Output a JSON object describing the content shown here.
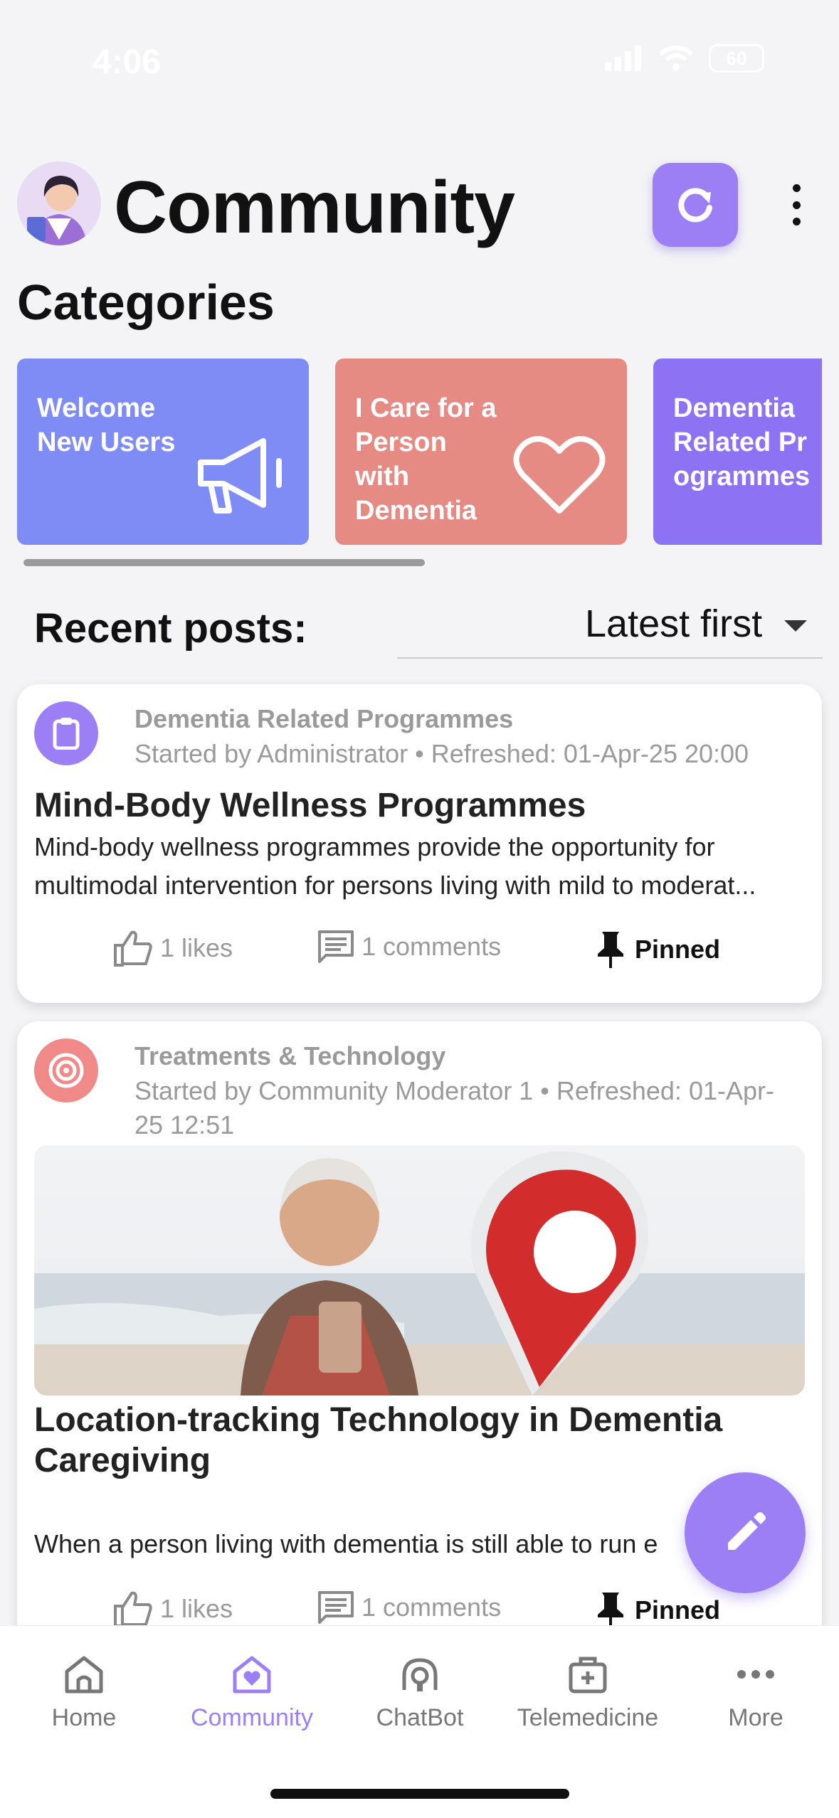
{
  "status_bar": {
    "time": "4:06",
    "battery": "60"
  },
  "header": {
    "title": "Community"
  },
  "categories_title": "Categories",
  "categories": [
    {
      "label": "Welcome\nNew Users",
      "color": "#7f8cf5",
      "icon": "megaphone-icon"
    },
    {
      "label": "I Care for a\nPerson\nwith\nDementia",
      "color": "#e58b84",
      "icon": "heart-icon"
    },
    {
      "label": "Dementia\nRelated Pr\nogrammes",
      "color": "#8d73f3",
      "icon": ""
    }
  ],
  "recent": {
    "title": "Recent posts:",
    "sort_value": "Latest first"
  },
  "posts": [
    {
      "category": "Dementia Related Programmes",
      "meta": "Started by Administrator • Refreshed: 01-Apr-25 20:00",
      "title": "Mind-Body Wellness Programmes",
      "excerpt": "Mind-body wellness programmes provide the opportunity for multimodal intervention for persons living with mild to moderat...",
      "likes": "1 likes",
      "comments": "1 comments",
      "pinned": "Pinned",
      "icon_color": "#9d7ff5",
      "icon": "clipboard-icon"
    },
    {
      "category": "Treatments & Technology",
      "meta": "Started by Community Moderator 1 • Refreshed: 01-Apr-25 12:51",
      "title": "Location-tracking Technology in Dementia Caregiving",
      "excerpt": "When a person living with dementia is still able to run e",
      "likes": "1 likes",
      "comments": "1 comments",
      "pinned": "Pinned",
      "icon_color": "#ef8a88",
      "icon": "target-icon"
    }
  ],
  "nav": [
    {
      "label": "Home",
      "icon": "home-icon"
    },
    {
      "label": "Community",
      "icon": "community-icon"
    },
    {
      "label": "ChatBot",
      "icon": "chatbot-icon"
    },
    {
      "label": "Telemedicine",
      "icon": "telemedicine-icon"
    },
    {
      "label": "More",
      "icon": "more-icon"
    }
  ],
  "colors": {
    "accent": "#9d7ff5",
    "muted": "#9a9a9a"
  }
}
